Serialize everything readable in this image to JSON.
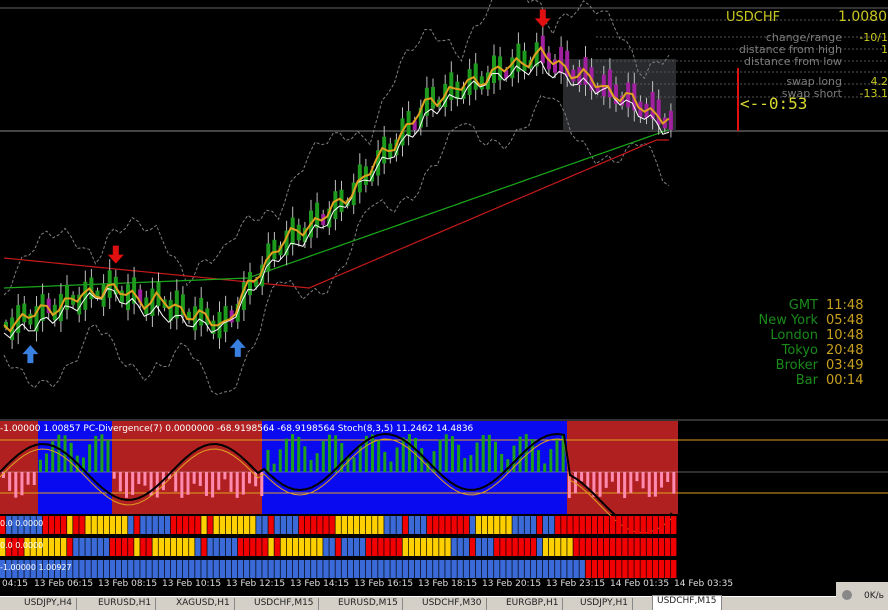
{
  "info": {
    "symbol": "USDCHF",
    "price": "1.0080",
    "rows": [
      {
        "label": "change/range",
        "value": "-10/1"
      },
      {
        "label": "distance from high",
        "value": "1"
      },
      {
        "label": "distance from low",
        "value": ""
      },
      {
        "label": "swap long",
        "value": "4.2"
      },
      {
        "label": "swap short",
        "value": "-13.1"
      }
    ],
    "countdown": "<--0:53"
  },
  "clocks": [
    {
      "label": "GMT",
      "time": "11:48"
    },
    {
      "label": "New York",
      "time": "05:48"
    },
    {
      "label": "London",
      "time": "10:48"
    },
    {
      "label": "Tokyo",
      "time": "20:48"
    },
    {
      "label": "Broker",
      "time": "03:49"
    },
    {
      "label": "Bar",
      "time": "00:14"
    }
  ],
  "indicator": {
    "label": "-1.00000 1.00857 PC-Divergence(7) 0.0000000 -68.9198564 -68.9198564 Stoch(8,3,5) 11.2462 14.4836"
  },
  "bar_rows": [
    {
      "label": "0.0 0.0000"
    },
    {
      "label": "0.0 0.0000"
    },
    {
      "label": "-1.00000 1.00927"
    }
  ],
  "xaxis": [
    "04:15",
    "13 Feb 06:15",
    "13 Feb 08:15",
    "13 Feb 10:15",
    "13 Feb 12:15",
    "13 Feb 14:15",
    "13 Feb 16:15",
    "13 Feb 18:15",
    "13 Feb 20:15",
    "13 Feb 23:15",
    "14 Feb 01:35",
    "14 Feb 03:35"
  ],
  "tabs": [
    {
      "label": "USDJPY,H4",
      "active": false
    },
    {
      "label": "EURUSD,H1",
      "active": false
    },
    {
      "label": "XAGUSD,H1",
      "active": false
    },
    {
      "label": "USDCHF,M15",
      "active": false
    },
    {
      "label": "EURUSD,M15",
      "active": false
    },
    {
      "label": "USDCHF,M30",
      "active": false
    },
    {
      "label": "EURGBP,H1",
      "active": false
    },
    {
      "label": "USDJPY,H1",
      "active": false
    },
    {
      "label": "USDCHF,M15",
      "active": true
    }
  ],
  "status": {
    "traffic": "0K/ь"
  },
  "colors": {
    "bull_candle": "#1e9a1e",
    "bear_candle": "#a020a0",
    "ema_fast": "#e0a020",
    "ema_white": "#ffffff",
    "ema_green": "#1aa81a",
    "ema_red": "#c81a1a",
    "band": "#808080",
    "zone_red": "#b02020",
    "zone_blue": "#0a0af0",
    "hist_green": "#1ea01e",
    "hist_pink": "#ff8ab0",
    "bar_blue": "#3a6ad8",
    "bar_red": "#f00000",
    "bar_yellow": "#ffd000"
  },
  "chart_data": {
    "type": "candlestick",
    "signals": [
      {
        "bar": 4,
        "dir": "up"
      },
      {
        "bar": 18,
        "dir": "down"
      },
      {
        "bar": 38,
        "dir": "up"
      },
      {
        "bar": 88,
        "dir": "down"
      }
    ],
    "up_arrows": 2
  }
}
